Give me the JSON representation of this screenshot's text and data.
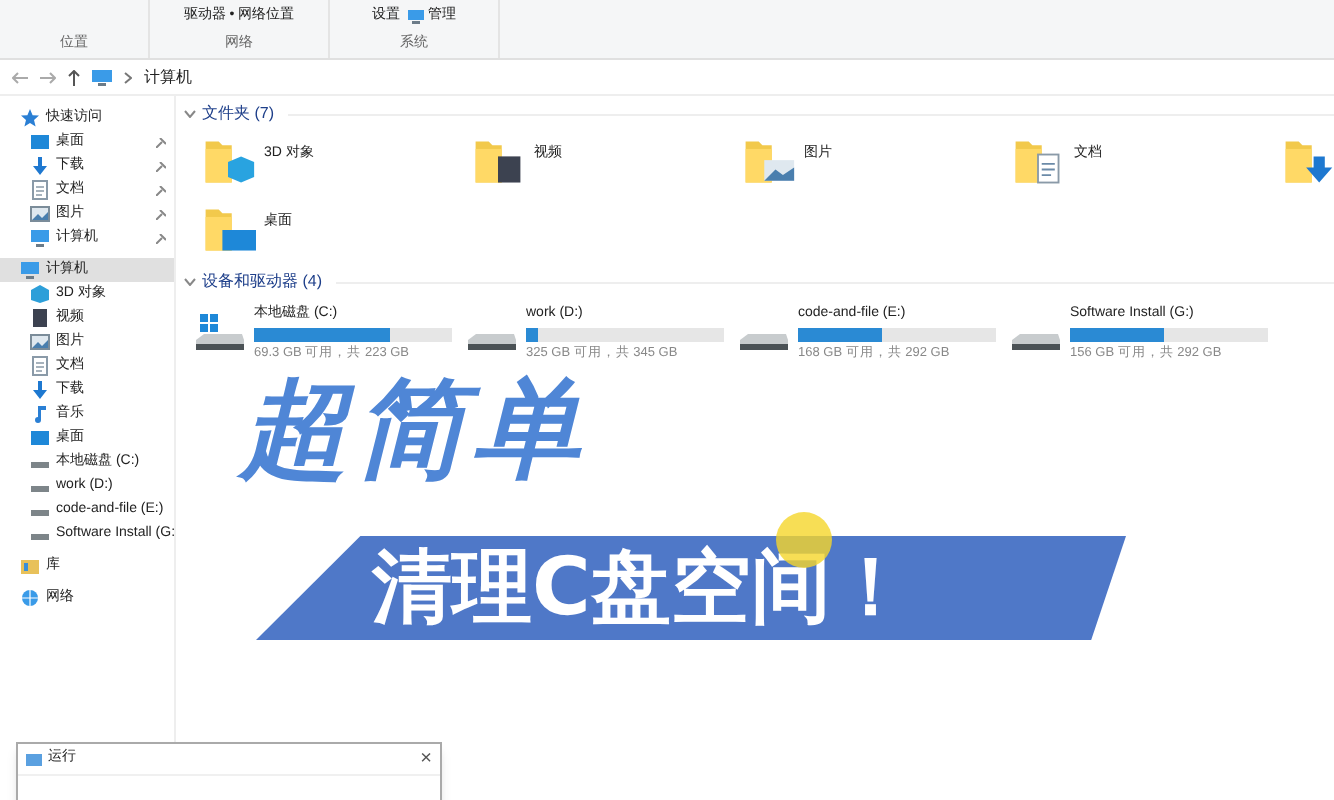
{
  "ribbon": {
    "groups": [
      {
        "label": "位置"
      },
      {
        "label": "网络",
        "items": [
          "驱动器 • 网络位置"
        ]
      },
      {
        "label": "系统",
        "items": [
          "设置",
          "管理"
        ]
      }
    ]
  },
  "address_bar": {
    "path": "计算机"
  },
  "sidebar": {
    "items": [
      {
        "label": "快速访问",
        "kind": "star",
        "selected": false,
        "pinned": false,
        "children": [
          {
            "label": "桌面",
            "kind": "desktop",
            "selected": false,
            "pinned": true
          },
          {
            "label": "下载",
            "kind": "download",
            "selected": false,
            "pinned": true
          },
          {
            "label": "文档",
            "kind": "doc",
            "selected": false,
            "pinned": true
          },
          {
            "label": "图片",
            "kind": "picture",
            "selected": false,
            "pinned": true
          },
          {
            "label": "计算机",
            "kind": "computer",
            "selected": false,
            "pinned": true
          }
        ]
      },
      {
        "label": "计算机",
        "kind": "computer",
        "selected": true,
        "pinned": false,
        "children": [
          {
            "label": "3D 对象",
            "kind": "cube",
            "selected": false,
            "pinned": false
          },
          {
            "label": "视频",
            "kind": "video",
            "selected": false,
            "pinned": false
          },
          {
            "label": "图片",
            "kind": "picture",
            "selected": false,
            "pinned": false
          },
          {
            "label": "文档",
            "kind": "doc",
            "selected": false,
            "pinned": false
          },
          {
            "label": "下载",
            "kind": "download",
            "selected": false,
            "pinned": false
          },
          {
            "label": "音乐",
            "kind": "music",
            "selected": false,
            "pinned": false
          },
          {
            "label": "桌面",
            "kind": "desktop",
            "selected": false,
            "pinned": false
          },
          {
            "label": "本地磁盘 (C:)",
            "kind": "drive",
            "selected": false,
            "pinned": false
          },
          {
            "label": "work (D:)",
            "kind": "drive",
            "selected": false,
            "pinned": false
          },
          {
            "label": "code-and-file (E:)",
            "kind": "drive",
            "selected": false,
            "pinned": false
          },
          {
            "label": "Software Install (G:",
            "kind": "drive",
            "selected": false,
            "pinned": false
          }
        ]
      },
      {
        "label": "库",
        "kind": "library",
        "selected": false,
        "pinned": false
      },
      {
        "label": "网络",
        "kind": "network",
        "selected": false,
        "pinned": false
      }
    ]
  },
  "folders": {
    "heading": "文件夹 (7)",
    "items": [
      {
        "label": "3D 对象",
        "kind": "cube"
      },
      {
        "label": "视频",
        "kind": "video"
      },
      {
        "label": "图片",
        "kind": "picture"
      },
      {
        "label": "文档",
        "kind": "doc"
      },
      {
        "kind": "download"
      },
      {
        "label": "桌面",
        "kind": "desktop"
      }
    ]
  },
  "drives": {
    "heading": "设备和驱动器 (4)",
    "items": [
      {
        "label": "本地磁盘 (C:)",
        "level": 0.69,
        "info": "69.3 GB 可用，共 223 GB",
        "system": true
      },
      {
        "label": "work (D:)",
        "level": 0.06,
        "info": "325 GB 可用，共 345 GB",
        "system": false
      },
      {
        "label": "code-and-file (E:)",
        "level": 0.42,
        "info": "168 GB 可用，共 292 GB",
        "system": false
      },
      {
        "label": "Software Install (G:)",
        "level": 0.47,
        "info": "156 GB 可用，共 292 GB",
        "system": false
      }
    ]
  },
  "overlay": {
    "headline": "超简单",
    "banner": "清理C盘空间！"
  },
  "run_dialog": {
    "title": "运行",
    "close": "×"
  }
}
